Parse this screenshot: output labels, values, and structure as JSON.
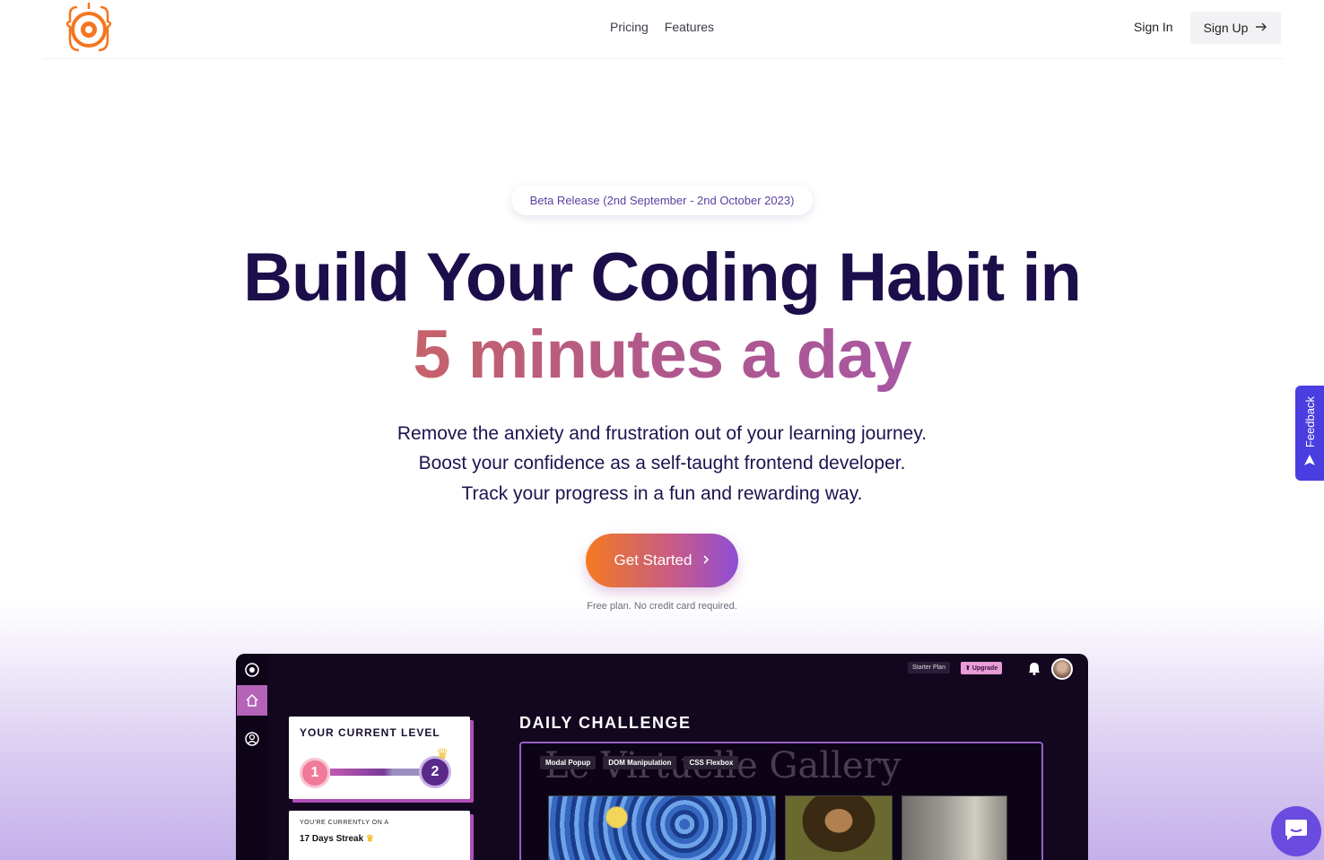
{
  "header": {
    "nav": [
      "Pricing",
      "Features"
    ],
    "sign_in": "Sign In",
    "sign_up": "Sign Up"
  },
  "hero": {
    "badge": "Beta Release (2nd September - 2nd October 2023)",
    "title_line1": "Build Your Coding Habit in",
    "title_line2": "5 minutes a day",
    "subtitle": [
      "Remove the anxiety and frustration out of your learning journey.",
      "Boost your confidence as a self-taught frontend developer.",
      "Track your progress in a fun and rewarding way."
    ],
    "cta": "Get Started",
    "note": "Free plan. No credit card required."
  },
  "feedback": {
    "label": "Feedback"
  },
  "app_preview": {
    "plan": "Starter Plan",
    "upgrade": "Upgrade",
    "level_card": {
      "title": "YOUR CURRENT LEVEL",
      "current": "1",
      "next": "2"
    },
    "streak_card": {
      "caption": "YOU'RE CURRENTLY ON A",
      "streak": "17 Days Streak"
    },
    "daily_title": "DAILY CHALLENGE",
    "challenge": {
      "heading": "Le Virtuelle Gallery",
      "tags": [
        "Modal Popup",
        "DOM Manipulation",
        "CSS Flexbox"
      ]
    }
  },
  "colors": {
    "brand_orange": "#f47a20",
    "brand_purple": "#8e4ed6",
    "dark_navy": "#1c0e4a"
  }
}
